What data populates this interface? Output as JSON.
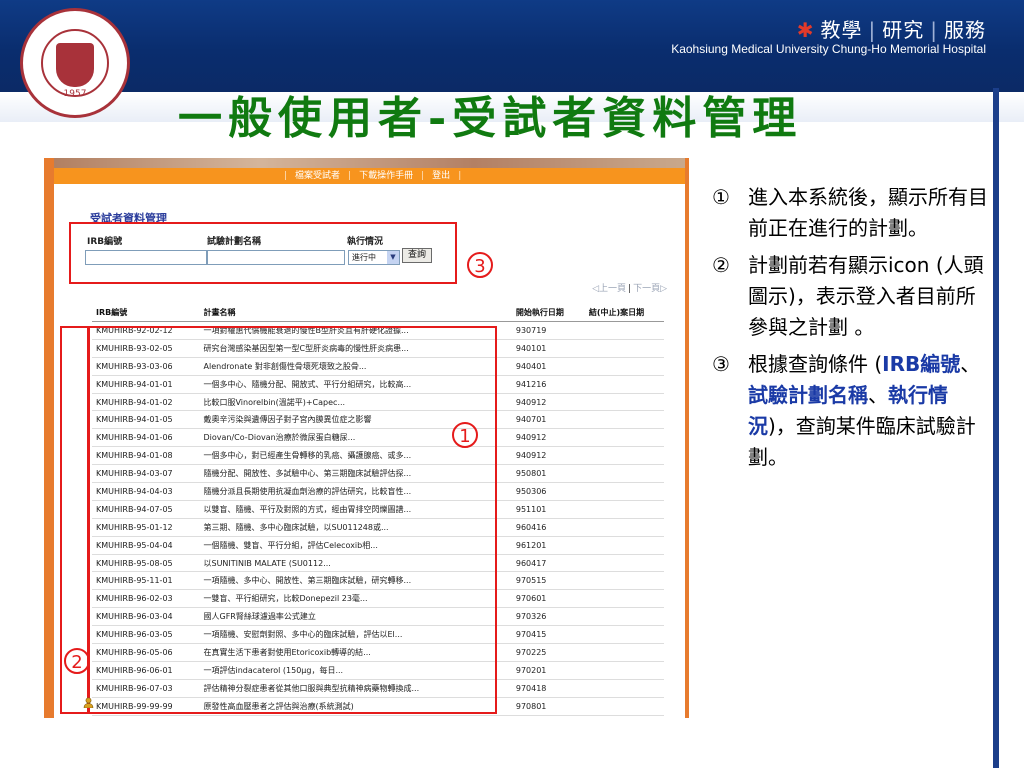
{
  "header": {
    "motto": [
      "教學",
      "研究",
      "服務"
    ],
    "hospital": "Kaohsiung Medical University  Chung-Ho Memorial Hospital",
    "logo_year": "1957"
  },
  "slide_title": "一般使用者-受試者資料管理",
  "screenshot": {
    "nav": [
      "|",
      "檔案受試者",
      "|",
      "下載操作手冊",
      "|",
      "登出",
      "|"
    ],
    "section_title": "受試者資料管理",
    "search": {
      "irb_label": "IRB編號",
      "plan_label": "試驗計劃名稱",
      "status_label": "執行情況",
      "status_value": "進行中",
      "query_button": "查詢"
    },
    "pager": {
      "prev": "◁上一頁",
      "sep": "|",
      "next": "下一頁▷"
    },
    "columns": [
      "IRB編號",
      "計畫名稱",
      "開始執行日期",
      "結(中止)案日期"
    ],
    "rows": [
      {
        "irb": "KMUHIRB-92-02-12",
        "name": "一項對權惠代償機能衰退的慢性B型肝炎且有肝硬化證據...",
        "start": "930719"
      },
      {
        "irb": "KMUHIRB-93-02-05",
        "name": "研究台灣感染基因型第一型C型肝炎病毒的慢性肝炎病患...",
        "start": "940101"
      },
      {
        "irb": "KMUHIRB-93-03-06",
        "name": "Alendronate 對非創傷性骨壞死壞致之股骨...",
        "start": "940401"
      },
      {
        "irb": "KMUHIRB-94-01-01",
        "name": "一個多中心、隨機分配、開放式、平行分組研究，比較高...",
        "start": "941216"
      },
      {
        "irb": "KMUHIRB-94-01-02",
        "name": "比較口服Vinorelbin(溫諾平)+Capec...",
        "start": "940912"
      },
      {
        "irb": "KMUHIRB-94-01-05",
        "name": "戴奧辛污染與遺傳因子對子宮內膜異位症之影響",
        "start": "940701"
      },
      {
        "irb": "KMUHIRB-94-01-06",
        "name": "Diovan/Co-Diovan治療於微尿蛋白糖尿...",
        "start": "940912"
      },
      {
        "irb": "KMUHIRB-94-01-08",
        "name": "一個多中心，對已經產生骨轉移的乳癌、攝護腺癌、或多...",
        "start": "940912"
      },
      {
        "irb": "KMUHIRB-94-03-07",
        "name": "隨機分配、開放性、多試驗中心、第三期臨床試驗評估探...",
        "start": "950801"
      },
      {
        "irb": "KMUHIRB-94-04-03",
        "name": "隨機分派且長期使用抗凝血劑治療的評估研究，比較盲性...",
        "start": "950306"
      },
      {
        "irb": "KMUHIRB-94-07-05",
        "name": "以雙盲、隨機、平行及對照的方式，經由胃排空閃爍圖譜...",
        "start": "951101"
      },
      {
        "irb": "KMUHIRB-95-01-12",
        "name": "第三期、隨機、多中心臨床試驗，以SU011248或...",
        "start": "960416"
      },
      {
        "irb": "KMUHIRB-95-04-04",
        "name": "一個隨機、雙盲、平行分組，評估Celecoxib相...",
        "start": "961201"
      },
      {
        "irb": "KMUHIRB-95-08-05",
        "name": "以SUNITINIB MALATE (SU0112...",
        "start": "960417"
      },
      {
        "irb": "KMUHIRB-95-11-01",
        "name": "一項隨機、多中心、開放性、第三期臨床試驗，研究轉移...",
        "start": "970515"
      },
      {
        "irb": "KMUHIRB-96-02-03",
        "name": "一雙盲、平行組研究，比較Donepezil 23毫...",
        "start": "970601"
      },
      {
        "irb": "KMUHIRB-96-03-04",
        "name": "國人GFR腎絲球濾過率公式建立",
        "start": "970326"
      },
      {
        "irb": "KMUHIRB-96-03-05",
        "name": "一項隨機、安慰劑對照、多中心的臨床試驗，評估以El...",
        "start": "970415"
      },
      {
        "irb": "KMUHIRB-96-05-06",
        "name": "在真實生活下患者對使用Etoricoxib轉導的結...",
        "start": "970225"
      },
      {
        "irb": "KMUHIRB-96-06-01",
        "name": "一項評估indacaterol (150μg，每日...",
        "start": "970201"
      },
      {
        "irb": "KMUHIRB-96-07-03",
        "name": "評估精神分裂症患者從其他口服與典型抗精神病藥物轉換成...",
        "start": "970418"
      },
      {
        "irb": "KMUHIRB-99-99-99",
        "name": "原發性高血壓患者之評估與治療(系統測試)",
        "start": "970801"
      }
    ],
    "markers": {
      "one": "1",
      "two": "2",
      "three": "3"
    }
  },
  "notes": [
    {
      "num": "①",
      "text": "進入本系統後，顯示所有目前正在進行的計劃。"
    },
    {
      "num": "②",
      "text": "計劃前若有顯示icon (人頭圖示)，表示登入者目前所參與之計劃 。"
    },
    {
      "num": "③",
      "pre": "根據查詢條件 (",
      "hl1": "IRB編號",
      "mid1": "、",
      "hl2": "試驗計劃名稱",
      "mid2": "、",
      "hl3": "執行情況",
      "post": ")，查詢某件臨床試驗計劃。"
    }
  ],
  "colors": {
    "title_green": "#107a10",
    "banner_blue": "#0f3b86",
    "highlight_red": "#e51b1b",
    "note_blue": "#1a3aa6",
    "nav_orange": "#f7941e"
  }
}
